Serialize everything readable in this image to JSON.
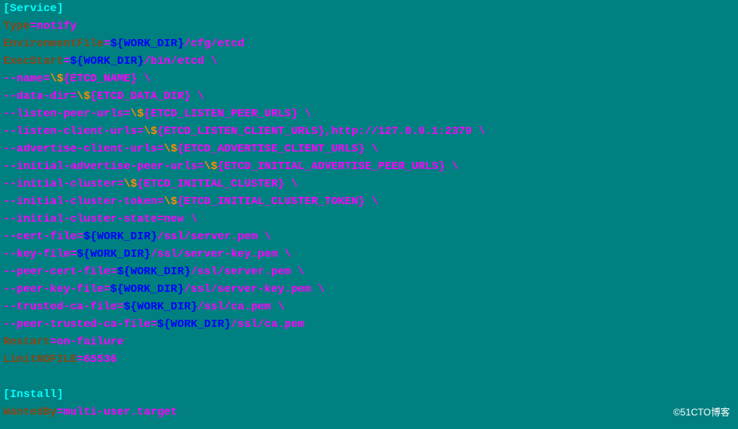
{
  "lines": [
    {
      "segments": [
        {
          "text": "[Service]",
          "color": "cyan"
        }
      ]
    },
    {
      "segments": [
        {
          "text": "Type",
          "color": "brown"
        },
        {
          "text": "=notify",
          "color": "magenta"
        }
      ]
    },
    {
      "segments": [
        {
          "text": "EnvironmentFile",
          "color": "brown"
        },
        {
          "text": "=",
          "color": "magenta"
        },
        {
          "text": "${WORK_DIR}",
          "color": "blue"
        },
        {
          "text": "/cfg/etcd",
          "color": "magenta"
        }
      ]
    },
    {
      "segments": [
        {
          "text": "ExecStart",
          "color": "brown"
        },
        {
          "text": "=",
          "color": "magenta"
        },
        {
          "text": "${WORK_DIR}",
          "color": "blue"
        },
        {
          "text": "/bin/etcd \\",
          "color": "magenta"
        }
      ]
    },
    {
      "segments": [
        {
          "text": "--name=",
          "color": "magenta"
        },
        {
          "text": "\\$",
          "color": "orange"
        },
        {
          "text": "{ETCD_NAME} \\",
          "color": "magenta"
        }
      ]
    },
    {
      "segments": [
        {
          "text": "--data-dir=",
          "color": "magenta"
        },
        {
          "text": "\\$",
          "color": "orange"
        },
        {
          "text": "{ETCD_DATA_DIR} \\",
          "color": "magenta"
        }
      ]
    },
    {
      "segments": [
        {
          "text": "--listen-peer-urls=",
          "color": "magenta"
        },
        {
          "text": "\\$",
          "color": "orange"
        },
        {
          "text": "{ETCD_LISTEN_PEER_URLS} \\",
          "color": "magenta"
        }
      ]
    },
    {
      "segments": [
        {
          "text": "--listen-client-urls=",
          "color": "magenta"
        },
        {
          "text": "\\$",
          "color": "orange"
        },
        {
          "text": "{ETCD_LISTEN_CLIENT_URLS},http://127.0.0.1:2379 \\",
          "color": "magenta"
        }
      ]
    },
    {
      "segments": [
        {
          "text": "--advertise-client-urls=",
          "color": "magenta"
        },
        {
          "text": "\\$",
          "color": "orange"
        },
        {
          "text": "{ETCD_ADVERTISE_CLIENT_URLS} \\",
          "color": "magenta"
        }
      ]
    },
    {
      "segments": [
        {
          "text": "--initial-advertise-peer-urls=",
          "color": "magenta"
        },
        {
          "text": "\\$",
          "color": "orange"
        },
        {
          "text": "{ETCD_INITIAL_ADVERTISE_PEER_URLS} \\",
          "color": "magenta"
        }
      ]
    },
    {
      "segments": [
        {
          "text": "--initial-cluster=",
          "color": "magenta"
        },
        {
          "text": "\\$",
          "color": "orange"
        },
        {
          "text": "{ETCD_INITIAL_CLUSTER} \\",
          "color": "magenta"
        }
      ]
    },
    {
      "segments": [
        {
          "text": "--initial-cluster-token=",
          "color": "magenta"
        },
        {
          "text": "\\$",
          "color": "orange"
        },
        {
          "text": "{ETCD_INITIAL_CLUSTER_TOKEN} \\",
          "color": "magenta"
        }
      ]
    },
    {
      "segments": [
        {
          "text": "--initial-cluster-state=new \\",
          "color": "magenta"
        }
      ]
    },
    {
      "segments": [
        {
          "text": "--cert-file=",
          "color": "magenta"
        },
        {
          "text": "${WORK_DIR}",
          "color": "blue"
        },
        {
          "text": "/ssl/server.pem \\",
          "color": "magenta"
        }
      ]
    },
    {
      "segments": [
        {
          "text": "--key-file=",
          "color": "magenta"
        },
        {
          "text": "${WORK_DIR}",
          "color": "blue"
        },
        {
          "text": "/ssl/server-key.pem \\",
          "color": "magenta"
        }
      ]
    },
    {
      "segments": [
        {
          "text": "--peer-cert-file=",
          "color": "magenta"
        },
        {
          "text": "${WORK_DIR}",
          "color": "blue"
        },
        {
          "text": "/ssl/server.pem \\",
          "color": "magenta"
        }
      ]
    },
    {
      "segments": [
        {
          "text": "--peer-key-file=",
          "color": "magenta"
        },
        {
          "text": "${WORK_DIR}",
          "color": "blue"
        },
        {
          "text": "/ssl/server-key.pem \\",
          "color": "magenta"
        }
      ]
    },
    {
      "segments": [
        {
          "text": "--trusted-ca-file=",
          "color": "magenta"
        },
        {
          "text": "${WORK_DIR}",
          "color": "blue"
        },
        {
          "text": "/ssl/ca.pem \\",
          "color": "magenta"
        }
      ]
    },
    {
      "segments": [
        {
          "text": "--peer-trusted-ca-file=",
          "color": "magenta"
        },
        {
          "text": "${WORK_DIR}",
          "color": "blue"
        },
        {
          "text": "/ssl/ca.pem",
          "color": "magenta"
        }
      ]
    },
    {
      "segments": [
        {
          "text": "Restart",
          "color": "brown"
        },
        {
          "text": "=on-failure",
          "color": "magenta"
        }
      ]
    },
    {
      "segments": [
        {
          "text": "LimitNOFILE",
          "color": "brown"
        },
        {
          "text": "=65536",
          "color": "magenta"
        }
      ]
    },
    {
      "segments": [
        {
          "text": " ",
          "color": "cyan"
        }
      ]
    },
    {
      "segments": [
        {
          "text": "[Install]",
          "color": "cyan"
        }
      ]
    },
    {
      "segments": [
        {
          "text": "WantedBy",
          "color": "brown"
        },
        {
          "text": "=multi-user.target",
          "color": "magenta"
        }
      ]
    }
  ],
  "watermark": "©51CTO博客"
}
